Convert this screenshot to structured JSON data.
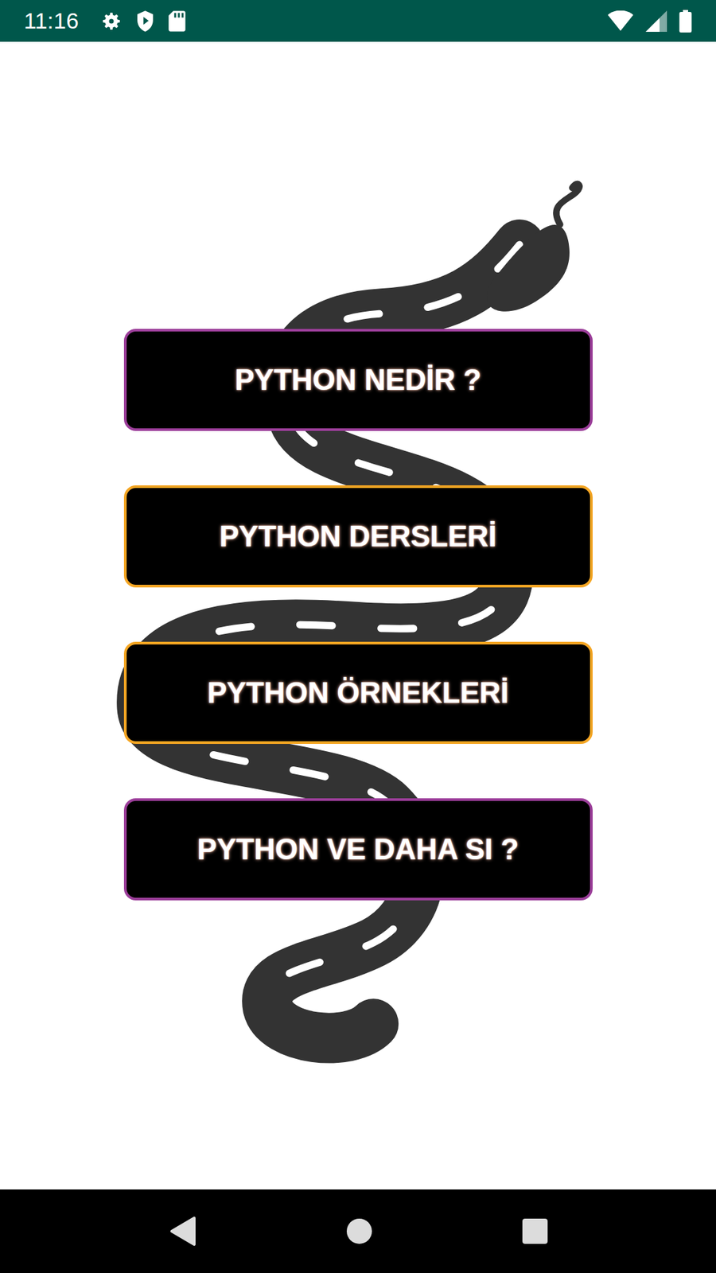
{
  "status_bar": {
    "time": "11:16"
  },
  "buttons": [
    {
      "label": "PYTHON NEDİR ?",
      "color": "#9c3e9a"
    },
    {
      "label": "PYTHON DERSLERİ",
      "color": "#f5a623"
    },
    {
      "label": "PYTHON ÖRNEKLERİ",
      "color": "#f5a623"
    },
    {
      "label": "PYTHON VE DAHA SI ?",
      "color": "#9c3e9a"
    }
  ]
}
